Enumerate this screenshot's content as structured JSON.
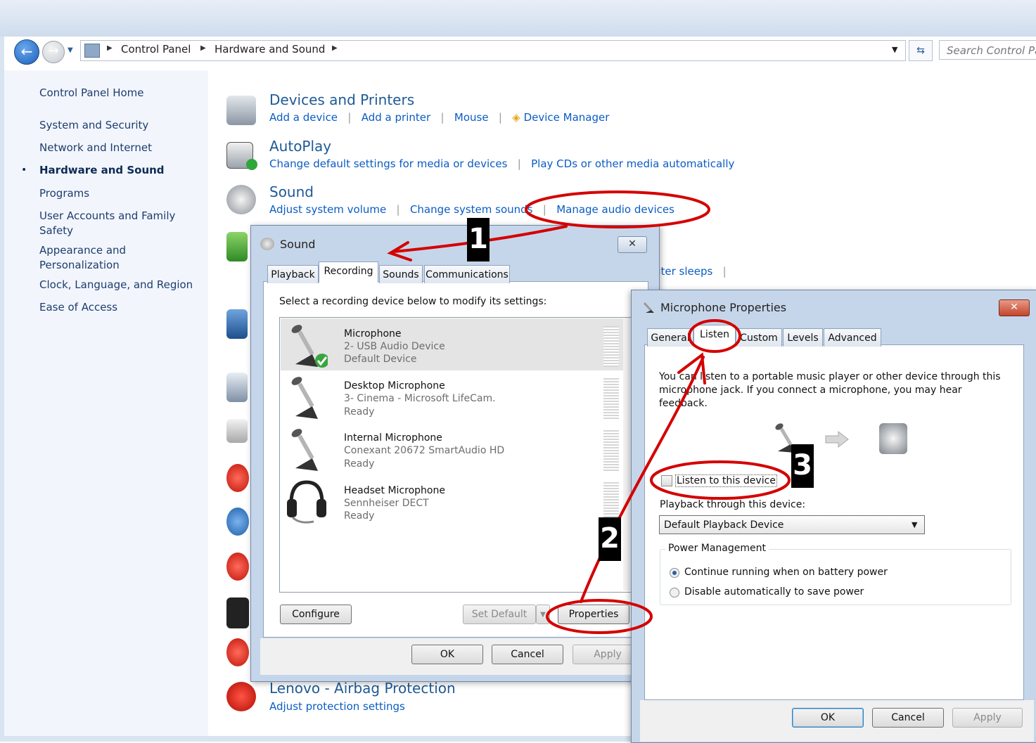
{
  "address": {
    "crumbs": [
      "Control Panel",
      "Hardware and Sound"
    ],
    "search_placeholder": "Search Control Pa"
  },
  "leftnav": {
    "home": "Control Panel Home",
    "items": [
      "System and Security",
      "Network and Internet",
      "Hardware and Sound",
      "Programs",
      "User Accounts and Family",
      "Safety",
      "Appearance and",
      "Personalization",
      "Clock, Language, and Region",
      "Ease of Access"
    ],
    "active_bullet": "•"
  },
  "categories": {
    "devices": {
      "title": "Devices and Printers",
      "links": [
        "Add a device",
        "Add a printer",
        "Mouse",
        "Device Manager"
      ]
    },
    "autoplay": {
      "title": "AutoPlay",
      "links": [
        "Change default settings for media or devices",
        "Play CDs or other media automatically"
      ]
    },
    "sound": {
      "title": "Sound",
      "links": [
        "Adjust system volume",
        "Change system sounds",
        "Manage audio devices"
      ]
    },
    "partial_link": "uter sleeps",
    "lenovo": {
      "title": "Lenovo - Airbag Protection",
      "links": [
        "Adjust protection settings"
      ]
    }
  },
  "sound_dialog": {
    "title": "Sound",
    "close": "✕",
    "tabs": [
      "Playback",
      "Recording",
      "Sounds",
      "Communications"
    ],
    "instruction": "Select a recording device below to modify its settings:",
    "devices": [
      {
        "name": "Microphone",
        "line1": "2- USB Audio Device",
        "line2": "Default Device"
      },
      {
        "name": "Desktop Microphone",
        "line1": "3- Cinema - Microsoft LifeCam.",
        "line2": "Ready"
      },
      {
        "name": "Internal Microphone",
        "line1": "Conexant 20672 SmartAudio HD",
        "line2": "Ready"
      },
      {
        "name": "Headset Microphone",
        "line1": "Sennheiser DECT",
        "line2": "Ready"
      }
    ],
    "buttons": {
      "configure": "Configure",
      "set_default": "Set Default",
      "properties": "Properties",
      "ok": "OK",
      "cancel": "Cancel",
      "apply": "Apply"
    }
  },
  "mic_dialog": {
    "title": "Microphone Properties",
    "close": "✕",
    "tabs": [
      "General",
      "Listen",
      "Custom",
      "Levels",
      "Advanced"
    ],
    "description": "You can listen to a portable music player or other device through this microphone jack.  If you connect a microphone, you may hear feedback.",
    "listen_checkbox": "Listen to this device",
    "listen_checked": false,
    "playback_label": "Playback through this device:",
    "playback_value": "Default Playback Device",
    "power_group": "Power Management",
    "power_options": [
      "Continue running when on battery power",
      "Disable automatically to save power"
    ],
    "power_selected_index": 0,
    "buttons": {
      "ok": "OK",
      "cancel": "Cancel",
      "apply": "Apply"
    }
  },
  "annotations": {
    "step1": "1",
    "step2": "2",
    "step3": "3",
    "color": "#d40000"
  }
}
